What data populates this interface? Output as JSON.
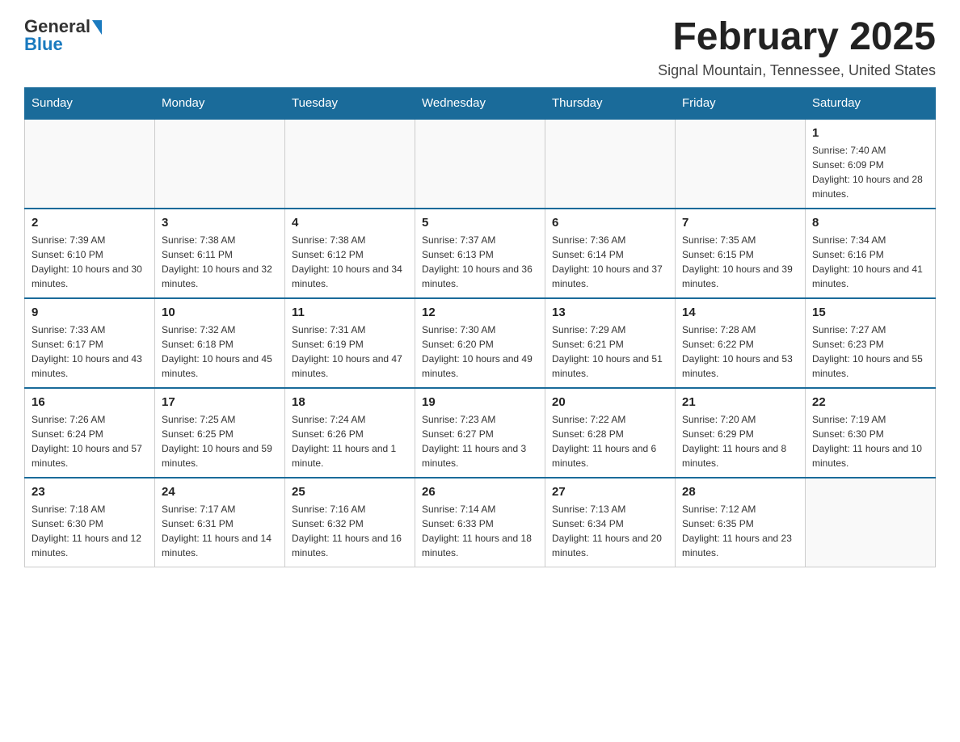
{
  "header": {
    "logo_general": "General",
    "logo_blue": "Blue",
    "month_title": "February 2025",
    "location": "Signal Mountain, Tennessee, United States"
  },
  "days_of_week": [
    "Sunday",
    "Monday",
    "Tuesday",
    "Wednesday",
    "Thursday",
    "Friday",
    "Saturday"
  ],
  "weeks": [
    [
      {
        "day": "",
        "info": ""
      },
      {
        "day": "",
        "info": ""
      },
      {
        "day": "",
        "info": ""
      },
      {
        "day": "",
        "info": ""
      },
      {
        "day": "",
        "info": ""
      },
      {
        "day": "",
        "info": ""
      },
      {
        "day": "1",
        "info": "Sunrise: 7:40 AM\nSunset: 6:09 PM\nDaylight: 10 hours and 28 minutes."
      }
    ],
    [
      {
        "day": "2",
        "info": "Sunrise: 7:39 AM\nSunset: 6:10 PM\nDaylight: 10 hours and 30 minutes."
      },
      {
        "day": "3",
        "info": "Sunrise: 7:38 AM\nSunset: 6:11 PM\nDaylight: 10 hours and 32 minutes."
      },
      {
        "day": "4",
        "info": "Sunrise: 7:38 AM\nSunset: 6:12 PM\nDaylight: 10 hours and 34 minutes."
      },
      {
        "day": "5",
        "info": "Sunrise: 7:37 AM\nSunset: 6:13 PM\nDaylight: 10 hours and 36 minutes."
      },
      {
        "day": "6",
        "info": "Sunrise: 7:36 AM\nSunset: 6:14 PM\nDaylight: 10 hours and 37 minutes."
      },
      {
        "day": "7",
        "info": "Sunrise: 7:35 AM\nSunset: 6:15 PM\nDaylight: 10 hours and 39 minutes."
      },
      {
        "day": "8",
        "info": "Sunrise: 7:34 AM\nSunset: 6:16 PM\nDaylight: 10 hours and 41 minutes."
      }
    ],
    [
      {
        "day": "9",
        "info": "Sunrise: 7:33 AM\nSunset: 6:17 PM\nDaylight: 10 hours and 43 minutes."
      },
      {
        "day": "10",
        "info": "Sunrise: 7:32 AM\nSunset: 6:18 PM\nDaylight: 10 hours and 45 minutes."
      },
      {
        "day": "11",
        "info": "Sunrise: 7:31 AM\nSunset: 6:19 PM\nDaylight: 10 hours and 47 minutes."
      },
      {
        "day": "12",
        "info": "Sunrise: 7:30 AM\nSunset: 6:20 PM\nDaylight: 10 hours and 49 minutes."
      },
      {
        "day": "13",
        "info": "Sunrise: 7:29 AM\nSunset: 6:21 PM\nDaylight: 10 hours and 51 minutes."
      },
      {
        "day": "14",
        "info": "Sunrise: 7:28 AM\nSunset: 6:22 PM\nDaylight: 10 hours and 53 minutes."
      },
      {
        "day": "15",
        "info": "Sunrise: 7:27 AM\nSunset: 6:23 PM\nDaylight: 10 hours and 55 minutes."
      }
    ],
    [
      {
        "day": "16",
        "info": "Sunrise: 7:26 AM\nSunset: 6:24 PM\nDaylight: 10 hours and 57 minutes."
      },
      {
        "day": "17",
        "info": "Sunrise: 7:25 AM\nSunset: 6:25 PM\nDaylight: 10 hours and 59 minutes."
      },
      {
        "day": "18",
        "info": "Sunrise: 7:24 AM\nSunset: 6:26 PM\nDaylight: 11 hours and 1 minute."
      },
      {
        "day": "19",
        "info": "Sunrise: 7:23 AM\nSunset: 6:27 PM\nDaylight: 11 hours and 3 minutes."
      },
      {
        "day": "20",
        "info": "Sunrise: 7:22 AM\nSunset: 6:28 PM\nDaylight: 11 hours and 6 minutes."
      },
      {
        "day": "21",
        "info": "Sunrise: 7:20 AM\nSunset: 6:29 PM\nDaylight: 11 hours and 8 minutes."
      },
      {
        "day": "22",
        "info": "Sunrise: 7:19 AM\nSunset: 6:30 PM\nDaylight: 11 hours and 10 minutes."
      }
    ],
    [
      {
        "day": "23",
        "info": "Sunrise: 7:18 AM\nSunset: 6:30 PM\nDaylight: 11 hours and 12 minutes."
      },
      {
        "day": "24",
        "info": "Sunrise: 7:17 AM\nSunset: 6:31 PM\nDaylight: 11 hours and 14 minutes."
      },
      {
        "day": "25",
        "info": "Sunrise: 7:16 AM\nSunset: 6:32 PM\nDaylight: 11 hours and 16 minutes."
      },
      {
        "day": "26",
        "info": "Sunrise: 7:14 AM\nSunset: 6:33 PM\nDaylight: 11 hours and 18 minutes."
      },
      {
        "day": "27",
        "info": "Sunrise: 7:13 AM\nSunset: 6:34 PM\nDaylight: 11 hours and 20 minutes."
      },
      {
        "day": "28",
        "info": "Sunrise: 7:12 AM\nSunset: 6:35 PM\nDaylight: 11 hours and 23 minutes."
      },
      {
        "day": "",
        "info": ""
      }
    ]
  ]
}
